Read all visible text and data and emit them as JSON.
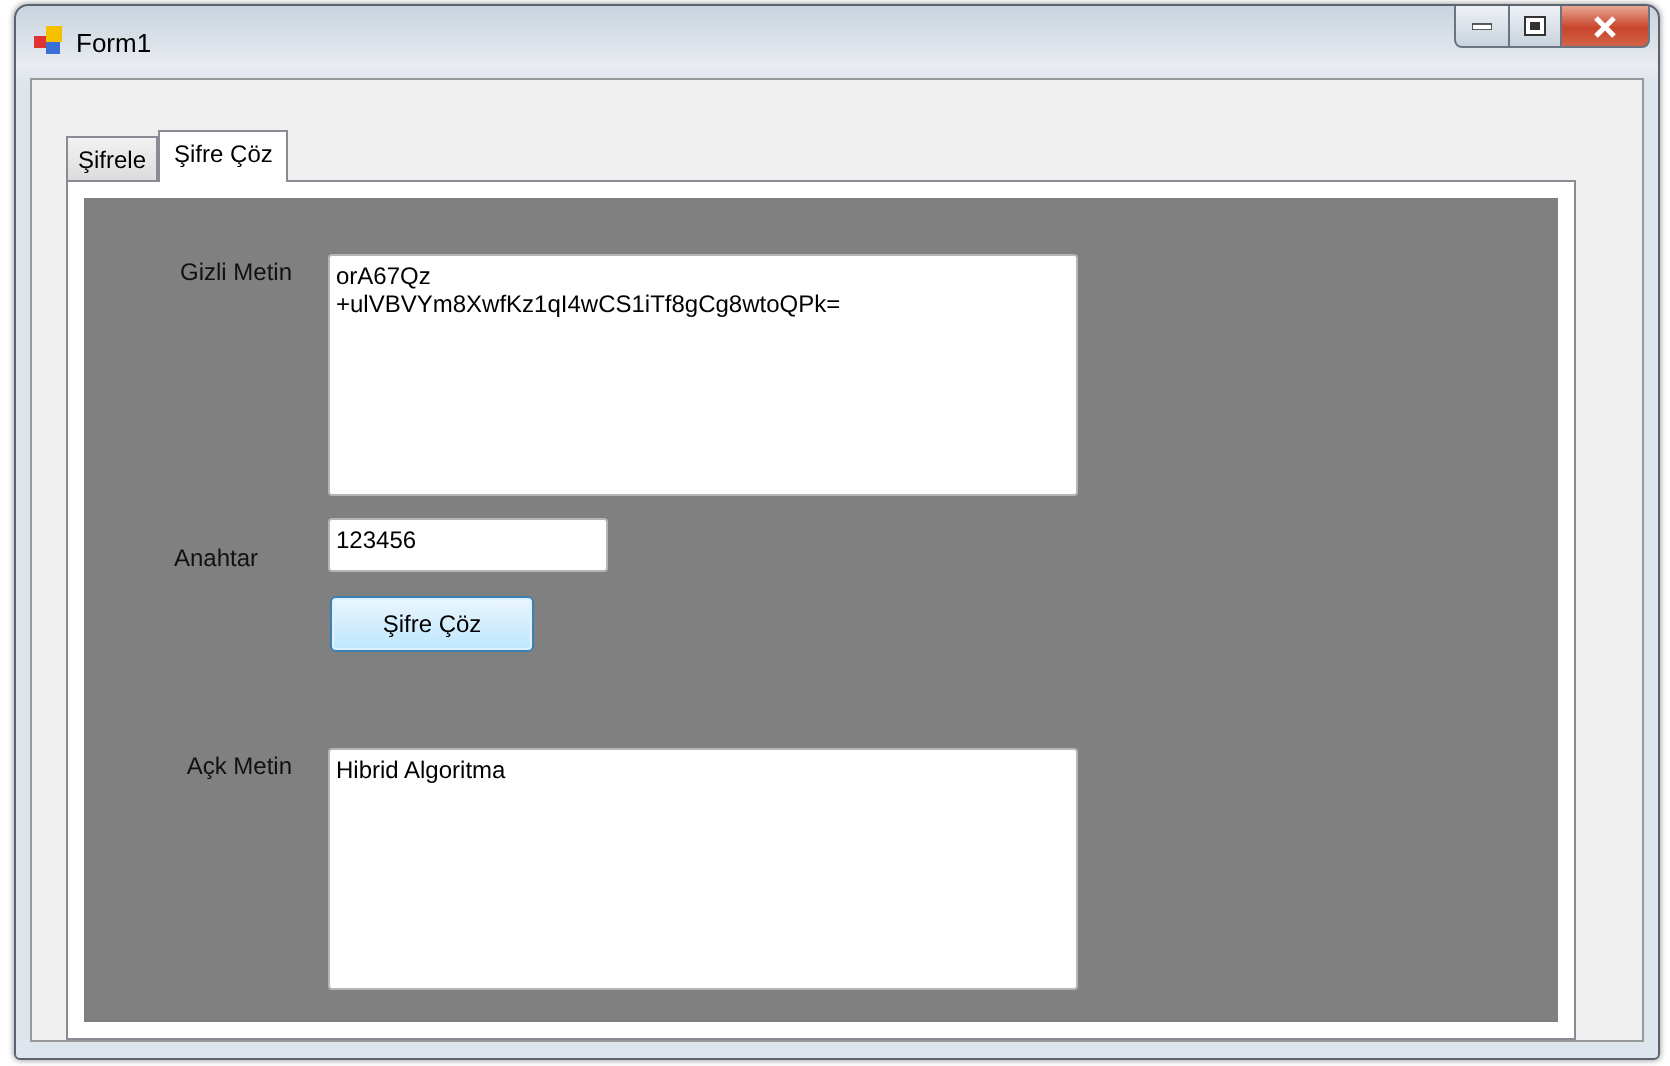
{
  "window": {
    "title": "Form1"
  },
  "tabs": [
    {
      "label": "Şifrele",
      "selected": false
    },
    {
      "label": "Şifre Çöz",
      "selected": true
    }
  ],
  "fields": [
    {
      "kind": "textarea",
      "label": "Gizli Metin",
      "value": "orA67Qz\n+ulVBVYm8XwfKz1qI4wCS1iTf8gCg8wtoQPk="
    },
    {
      "kind": "input",
      "label": "Anahtar",
      "value": "123456"
    },
    {
      "kind": "button",
      "label": "Şifre Çöz"
    },
    {
      "kind": "textarea",
      "label": "Açk Metin",
      "value": "Hibrid Algoritma"
    }
  ]
}
